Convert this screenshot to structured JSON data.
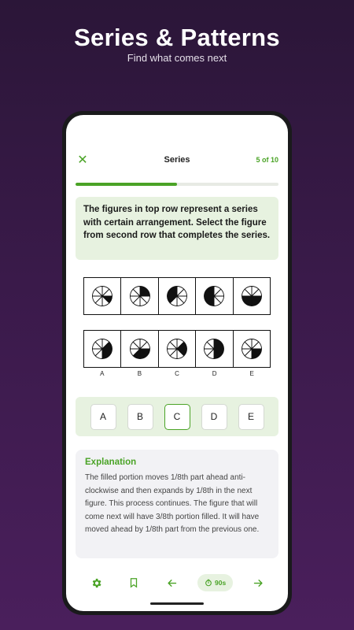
{
  "promo": {
    "title": "Series & Patterns",
    "subtitle": "Find what comes next"
  },
  "appbar": {
    "title": "Series",
    "progress_label": "5 of 10",
    "progress_fraction": 0.5
  },
  "question": {
    "text": "The figures in top row represent a series with certain arrangement. Select the figure from second row that completes the series."
  },
  "figures": {
    "top_row": [
      {
        "filled_sectors": [
          2
        ]
      },
      {
        "filled_sectors": [
          0,
          1
        ]
      },
      {
        "filled_sectors": [
          5,
          6,
          7
        ]
      },
      {
        "filled_sectors": [
          4,
          5,
          6,
          7
        ]
      },
      {
        "filled_sectors": [
          2,
          3,
          4,
          5
        ]
      }
    ],
    "bottom_row": [
      {
        "filled_sectors": [
          1,
          2,
          3
        ]
      },
      {
        "filled_sectors": [
          2,
          3,
          4
        ]
      },
      {
        "filled_sectors": [
          1,
          2
        ]
      },
      {
        "filled_sectors": [
          0,
          1,
          2,
          3
        ]
      },
      {
        "filled_sectors": [
          2,
          3
        ]
      }
    ],
    "letters": [
      "A",
      "B",
      "C",
      "D",
      "E"
    ]
  },
  "options": {
    "items": [
      "A",
      "B",
      "C",
      "D",
      "E"
    ],
    "selected": "C",
    "accent_color": "#4aa326"
  },
  "explanation": {
    "title": "Explanation",
    "body": "The filled portion moves 1/8th part ahead anti-clockwise and then expands by 1/8th in the next figure. This process continues. The figure that will come next will have 3/8th portion filled. It will have moved ahead by 1/8th part from the previous one."
  },
  "bottom_bar": {
    "timer_label": "90s",
    "icons": [
      "settings-icon",
      "bookmark-icon",
      "arrow-left-icon",
      "timer-icon",
      "arrow-right-icon"
    ]
  }
}
